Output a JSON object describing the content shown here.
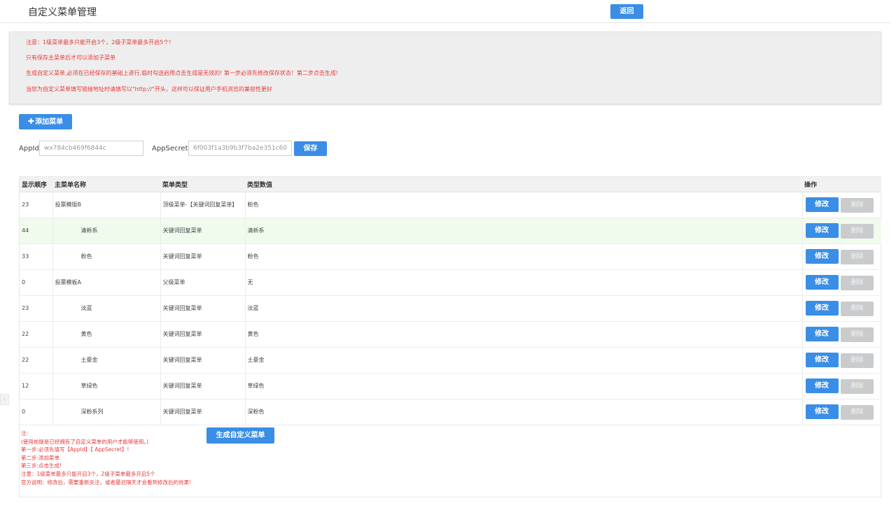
{
  "header": {
    "title": "自定义菜单管理",
    "back_label": "返回"
  },
  "notice": {
    "lines": [
      "注意：1级菜单最多只能开启3个，2级子菜单最多开启5个!",
      "只有保存主菜单后才可以添加子菜单",
      "生成自定义菜单,必须在已经保存的基础上进行,临时勾选启用点击生成是无效的! 第一步必须先修改保存状态！第二步点击生成!",
      "当您为自定义菜单填写链接地址时请填写以\"http://\"开头，这样可以保证用户手机浏览的兼容性更好"
    ]
  },
  "toolbar": {
    "add_icon": "plus-icon",
    "add_label": "添加菜单"
  },
  "credentials": {
    "appid_label": "AppId:",
    "appid_value": "wx784cb469f6844c",
    "secret_label": "AppSecret:",
    "secret_value": "6f003f1a3b9b3f7ba2e351c60",
    "save_label": "保存"
  },
  "table": {
    "headers": {
      "order": "显示顺序",
      "name": "主菜单名称",
      "type": "菜单类型",
      "value": "类型数值",
      "ops": "操作"
    },
    "edit_label": "修改",
    "delete_label": "删除",
    "rows": [
      {
        "order": "23",
        "name": "投票模版B",
        "type": "顶级菜单-【关键词回复菜单】",
        "value": "粉色"
      },
      {
        "order": "44",
        "name": "清新系",
        "type": "关键词回复菜单",
        "value": "清新系"
      },
      {
        "order": "33",
        "name": "粉色",
        "type": "关键词回复菜单",
        "value": "粉色"
      },
      {
        "order": "0",
        "name": "投票模板A",
        "type": "父级菜单",
        "value": "无"
      },
      {
        "order": "23",
        "name": "淡蓝",
        "type": "关键词回复菜单",
        "value": "淡蓝"
      },
      {
        "order": "22",
        "name": "黄色",
        "type": "关键词回复菜单",
        "value": "黄色"
      },
      {
        "order": "22",
        "name": "土豪金",
        "type": "关键词回复菜单",
        "value": "土豪金"
      },
      {
        "order": "12",
        "name": "草绿色",
        "type": "关键词回复菜单",
        "value": "草绿色"
      },
      {
        "order": "0",
        "name": "深粉系列",
        "type": "关键词回复菜单",
        "value": "深粉色"
      }
    ]
  },
  "footer": {
    "notes": [
      "注:",
      "(使用前提是已经拥有了自定义菜单的用户才能够使用。)",
      "第一步:必须先填写【AppId】【 AppSecret】!",
      "第二步:添加菜单.",
      "第三步:点击生成!",
      "注意：1级菜单最多只能开启3个，2级子菜单最多开启5个",
      "官方说明：修改后，需要重新关注，或者最迟隔天才会看到修改后的效果!"
    ],
    "generate_label": "生成自定义菜单"
  },
  "side": {
    "icon": "chevron-left-icon"
  },
  "colors": {
    "primary": "#3a8ee6",
    "warning_text": "#e83a3a",
    "disabled": "#c9cbcd",
    "highlight_row": "#f0fbee"
  }
}
